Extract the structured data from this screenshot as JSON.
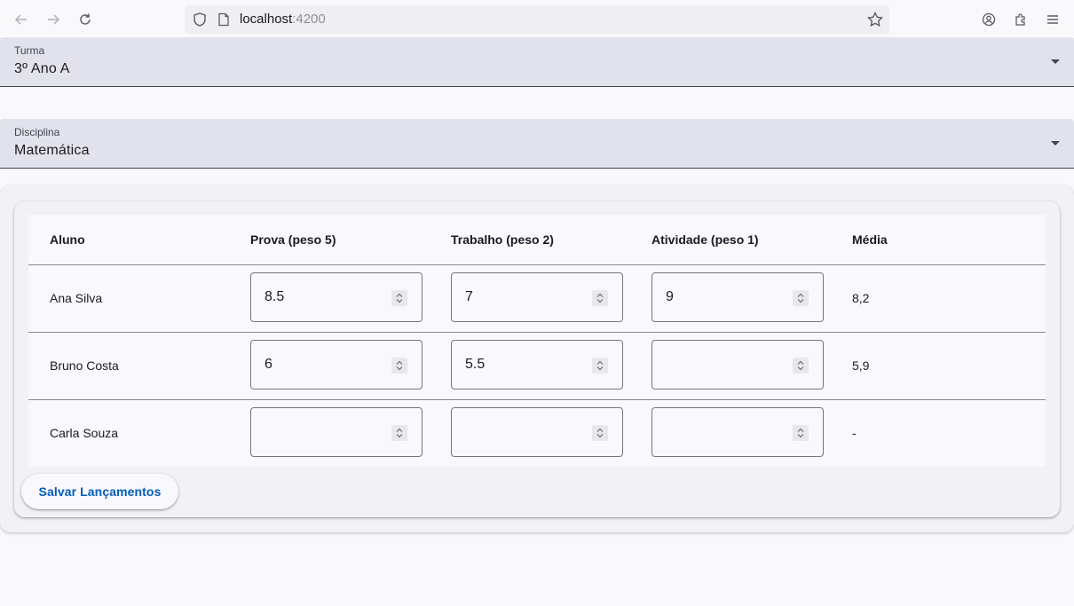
{
  "browser": {
    "url_host": "localhost",
    "url_port": ":4200"
  },
  "form": {
    "turma": {
      "label": "Turma",
      "value": "3º Ano A"
    },
    "disciplina": {
      "label": "Disciplina",
      "value": "Matemática"
    }
  },
  "table": {
    "headers": [
      "Aluno",
      "Prova (peso 5)",
      "Trabalho (peso 2)",
      "Atividade (peso 1)",
      "Média"
    ],
    "rows": [
      {
        "aluno": "Ana Silva",
        "prova": "8.5",
        "trabalho": "7",
        "atividade": "9",
        "media": "8,2"
      },
      {
        "aluno": "Bruno Costa",
        "prova": "6",
        "trabalho": "5.5",
        "atividade": "",
        "media": "5,9"
      },
      {
        "aluno": "Carla Souza",
        "prova": "",
        "trabalho": "",
        "atividade": "",
        "media": "-"
      }
    ]
  },
  "actions": {
    "save_label": "Salvar Lançamentos"
  },
  "colors": {
    "primary": "#005cbb",
    "field_bg": "#e1e2ec",
    "surface": "#f9f8fc"
  }
}
